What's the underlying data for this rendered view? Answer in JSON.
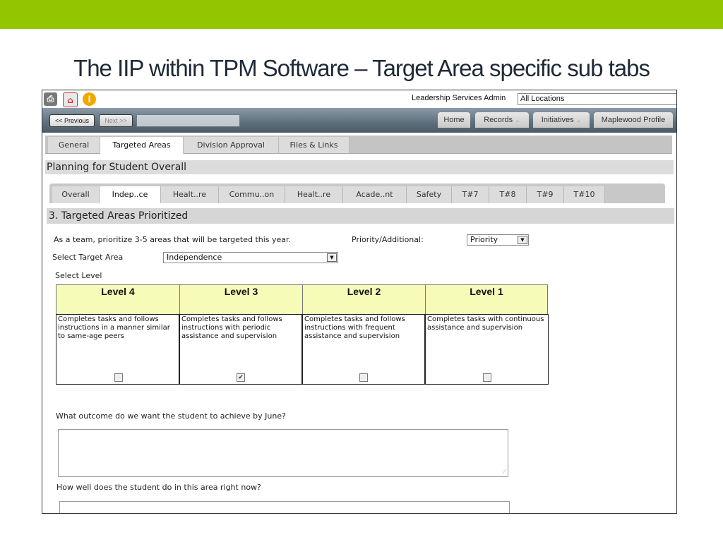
{
  "slide": {
    "title": "The IIP within TPM Software – Target Area specific sub tabs",
    "accent_color": "#94c600"
  },
  "header": {
    "icons": [
      "print-icon",
      "home-icon",
      "info-icon"
    ],
    "user": "Leadership Services Admin",
    "location": "All Locations"
  },
  "nav": {
    "previous": "<< Previous",
    "next": "Next >>",
    "tabs": [
      "Home",
      "Records",
      "Initiatives",
      "Maplewood Profile"
    ]
  },
  "main_tabs": [
    "General",
    "Targeted Areas",
    "Division Approval",
    "Files & Links"
  ],
  "main_active": "Targeted Areas",
  "section_title": "Planning for Student Overall",
  "sub_tabs": [
    "Overall",
    "Indep..ce",
    "Healt..re",
    "Commu..on",
    "Healt..re",
    "Acade..nt",
    "Safety",
    "T#7",
    "T#8",
    "T#9",
    "T#10"
  ],
  "sub_active": "Indep..ce",
  "subsection_title": "3. Targeted Areas Prioritized",
  "form": {
    "instruction": "As a team, prioritize 3-5 areas that will be targeted this year.",
    "priority_label": "Priority/Additional:",
    "priority_value": "Priority",
    "target_label": "Select Target Area",
    "target_value": "Independence",
    "level_label": "Select Level",
    "levels": [
      {
        "name": "Level 4",
        "desc": "Completes tasks and follows instructions in a manner similar to same-age peers",
        "checked": false
      },
      {
        "name": "Level 3",
        "desc": "Completes tasks and follows instructions with periodic assistance and supervision",
        "checked": true
      },
      {
        "name": "Level 2",
        "desc": "Completes tasks and follows instructions with frequent assistance and supervision",
        "checked": false
      },
      {
        "name": "Level 1",
        "desc": "Completes tasks with continuous assistance and supervision",
        "checked": false
      }
    ],
    "q1": "What outcome do we want the student to achieve by June?",
    "q2": "How well does the student do in this area right now?"
  }
}
